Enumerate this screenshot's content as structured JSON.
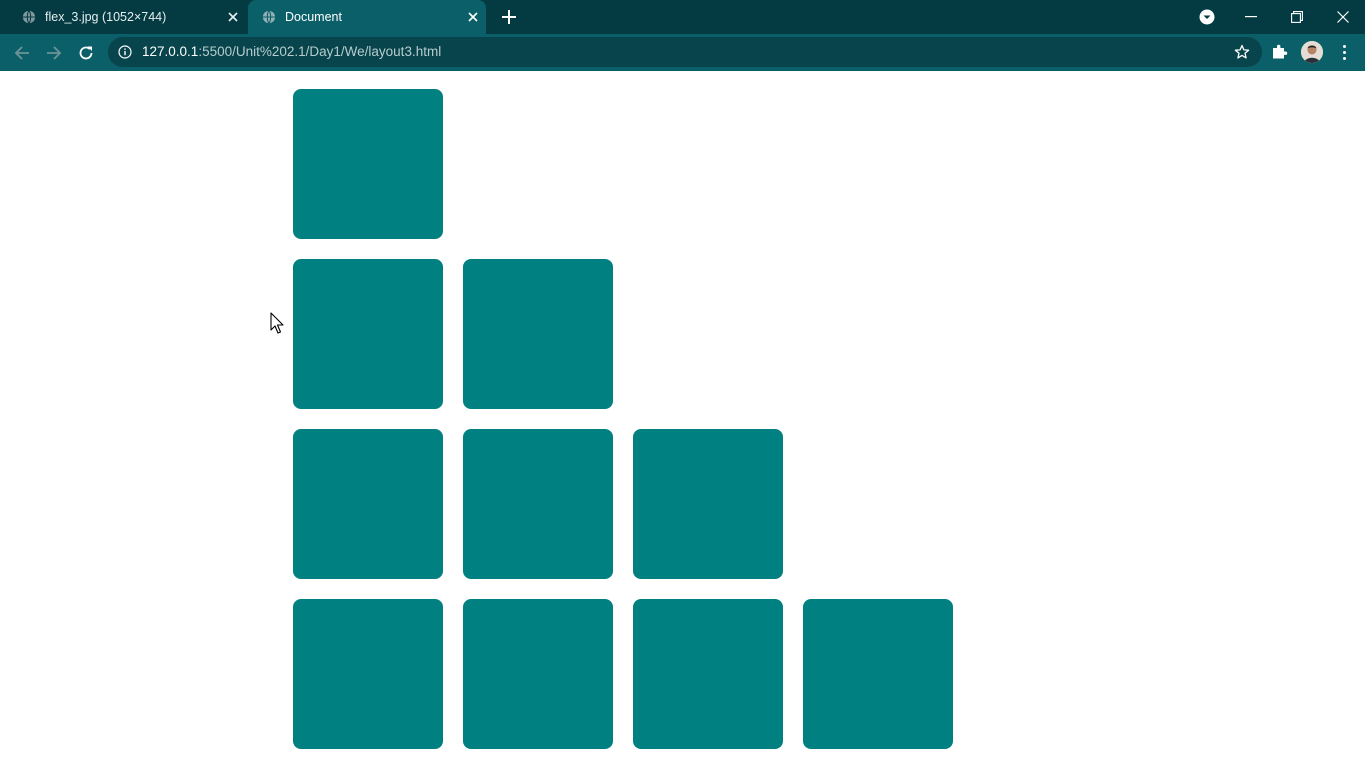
{
  "tabs": [
    {
      "title": "flex_3.jpg (1052×744)",
      "active": false
    },
    {
      "title": "Document",
      "active": true
    }
  ],
  "address_bar": {
    "url_host": "127.0.0.1",
    "url_rest": ":5500/Unit%202.1/Day1/We/layout3.html"
  },
  "icons": {
    "back": "arrow-left-icon",
    "forward": "arrow-right-icon",
    "reload": "reload-icon",
    "site_info": "info-icon",
    "bookmark": "star-icon",
    "extensions": "puzzle-icon",
    "menu": "kebab-menu-icon",
    "tab_favicon": "globe-icon",
    "tab_search": "chevron-down-icon"
  },
  "layout": {
    "rows": [
      1,
      2,
      3,
      4
    ],
    "box_color": "#008080"
  },
  "colors": {
    "tabbar": "#043a41",
    "toolbar": "#0b5f68",
    "page": "#ffffff"
  }
}
